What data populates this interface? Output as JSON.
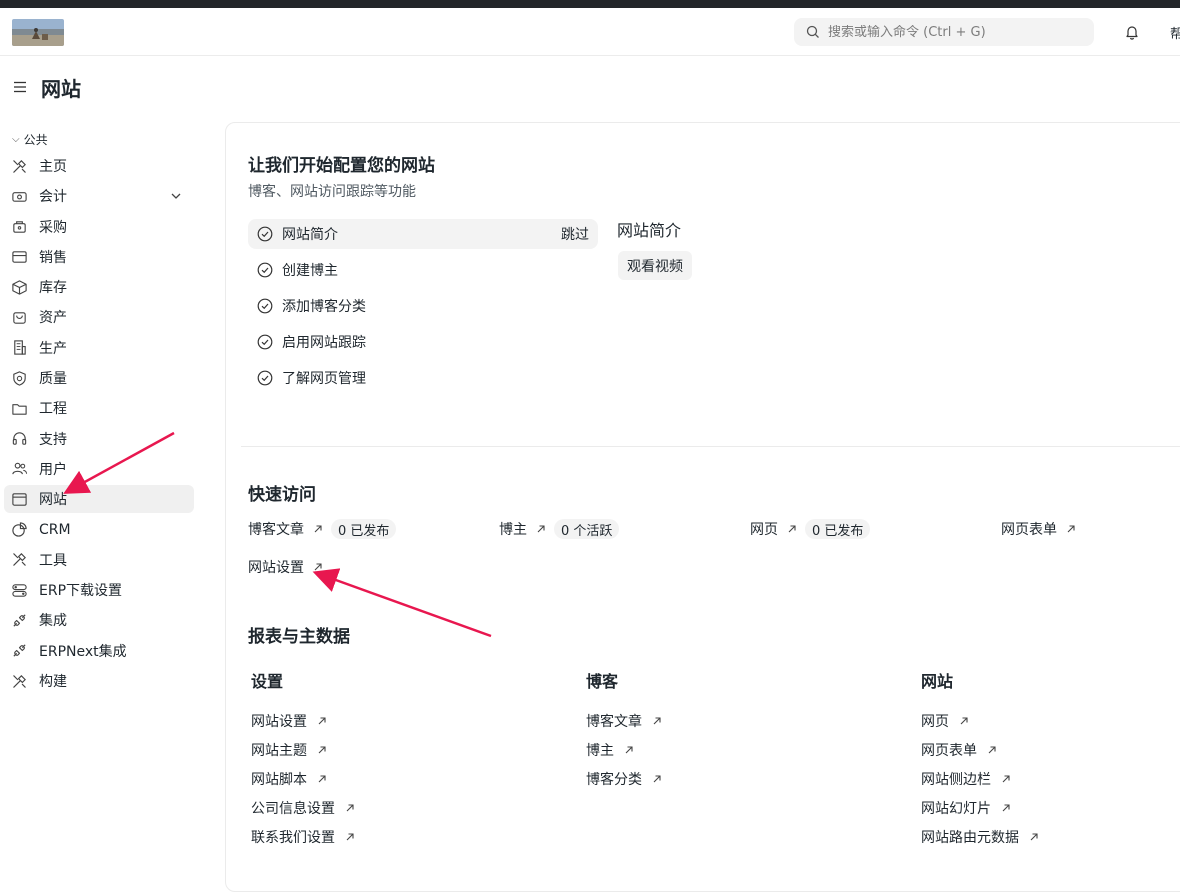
{
  "navbar": {
    "search_placeholder": "搜索或输入命令 (Ctrl + G)",
    "help_label": "帮"
  },
  "page": {
    "title": "网站"
  },
  "sidebar": {
    "group_label": "公共",
    "items": [
      {
        "label": "主页",
        "icon": "tools-icon"
      },
      {
        "label": "会计",
        "icon": "accounting-icon"
      },
      {
        "label": "采购",
        "icon": "purchase-icon"
      },
      {
        "label": "销售",
        "icon": "sales-icon"
      },
      {
        "label": "库存",
        "icon": "stock-icon"
      },
      {
        "label": "资产",
        "icon": "assets-icon"
      },
      {
        "label": "生产",
        "icon": "building-icon"
      },
      {
        "label": "质量",
        "icon": "quality-icon"
      },
      {
        "label": "工程",
        "icon": "folder-icon"
      },
      {
        "label": "支持",
        "icon": "headset-icon"
      },
      {
        "label": "用户",
        "icon": "users-icon"
      },
      {
        "label": "网站",
        "icon": "website-icon"
      },
      {
        "label": "CRM",
        "icon": "crm-icon"
      },
      {
        "label": "工具",
        "icon": "tools-icon"
      },
      {
        "label": "ERP下载设置",
        "icon": "toggle-icon"
      },
      {
        "label": "集成",
        "icon": "integration-icon"
      },
      {
        "label": "ERPNext集成",
        "icon": "integration-icon"
      },
      {
        "label": "构建",
        "icon": "tools-icon"
      }
    ],
    "active_index": 11
  },
  "onboarding": {
    "title": "让我们开始配置您的网站",
    "subtitle": "博客、网站访问跟踪等功能",
    "steps": [
      {
        "label": "网站简介",
        "active": true
      },
      {
        "label": "创建博主"
      },
      {
        "label": "添加博客分类"
      },
      {
        "label": "启用网站跟踪"
      },
      {
        "label": "了解网页管理"
      }
    ],
    "skip_label": "跳过",
    "detail_title": "网站简介",
    "watch_video_label": "观看视频"
  },
  "quick_access": {
    "title": "快速访问",
    "items": [
      {
        "label": "博客文章",
        "count": "0 已发布"
      },
      {
        "label": "博主",
        "count": "0 个活跃"
      },
      {
        "label": "网页",
        "count": "0 已发布"
      },
      {
        "label": "网页表单"
      },
      {
        "label": "网站设置"
      }
    ]
  },
  "reports": {
    "title": "报表与主数据",
    "columns": [
      {
        "heading": "设置",
        "links": [
          "网站设置",
          "网站主题",
          "网站脚本",
          "公司信息设置",
          "联系我们设置"
        ]
      },
      {
        "heading": "博客",
        "links": [
          "博客文章",
          "博主",
          "博客分类"
        ]
      },
      {
        "heading": "网站",
        "links": [
          "网页",
          "网页表单",
          "网站侧边栏",
          "网站幻灯片",
          "网站路由元数据"
        ]
      }
    ]
  },
  "colors": {
    "annotation_arrow": "#e8174f",
    "active_bg": "#f0f0f0",
    "pill_bg": "#f3f3f3",
    "text": "#1f272e"
  }
}
